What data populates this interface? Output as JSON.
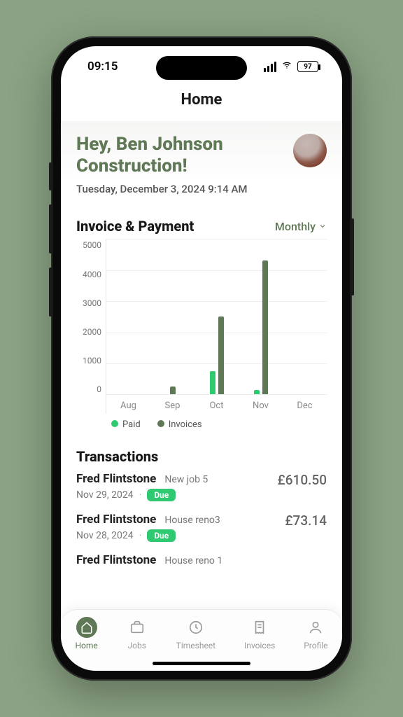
{
  "status": {
    "time": "09:15",
    "battery": "97"
  },
  "header": {
    "title": "Home"
  },
  "greeting": {
    "text": "Hey, Ben Johnson Construction!",
    "datetime": "Tuesday, December 3, 2024 9:14 AM"
  },
  "chart_section": {
    "title": "Invoice & Payment",
    "period": "Monthly"
  },
  "chart_data": {
    "type": "bar",
    "categories": [
      "Aug",
      "Sep",
      "Oct",
      "Nov",
      "Dec"
    ],
    "series": [
      {
        "name": "Paid",
        "values": [
          0,
          0,
          750,
          150,
          0
        ]
      },
      {
        "name": "Invoices",
        "values": [
          0,
          250,
          2500,
          4300,
          0
        ]
      }
    ],
    "ylim": [
      0,
      5000
    ],
    "yticks": [
      0,
      1000,
      2000,
      3000,
      4000,
      5000
    ],
    "colors": {
      "Paid": "#2ec971",
      "Invoices": "#5f7855"
    }
  },
  "transactions": {
    "title": "Transactions",
    "items": [
      {
        "name": "Fred Flintstone",
        "job": "New job 5",
        "date": "Nov 29, 2024",
        "status": "Due",
        "amount": "£610.50"
      },
      {
        "name": "Fred Flintstone",
        "job": "House reno3",
        "date": "Nov 28, 2024",
        "status": "Due",
        "amount": "£73.14"
      },
      {
        "name": "Fred Flintstone",
        "job": "House reno 1",
        "date": "",
        "status": "",
        "amount": ""
      }
    ]
  },
  "nav": {
    "items": [
      {
        "key": "home",
        "label": "Home",
        "active": true
      },
      {
        "key": "jobs",
        "label": "Jobs",
        "active": false
      },
      {
        "key": "timesheet",
        "label": "Timesheet",
        "active": false
      },
      {
        "key": "invoices",
        "label": "Invoices",
        "active": false
      },
      {
        "key": "profile",
        "label": "Profile",
        "active": false
      }
    ]
  }
}
